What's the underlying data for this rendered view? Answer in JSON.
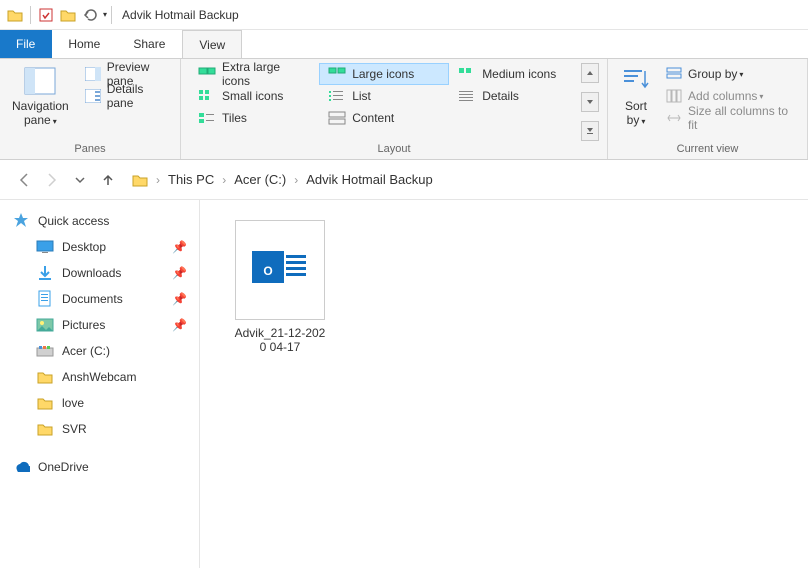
{
  "window": {
    "title": "Advik Hotmail Backup"
  },
  "tabs": {
    "file": "File",
    "home": "Home",
    "share": "Share",
    "view": "View"
  },
  "ribbon": {
    "panes": {
      "title": "Panes",
      "navigation_l1": "Navigation",
      "navigation_l2": "pane",
      "preview": "Preview pane",
      "details": "Details pane"
    },
    "layout": {
      "title": "Layout",
      "extra_large": "Extra large icons",
      "large": "Large icons",
      "medium": "Medium icons",
      "small": "Small icons",
      "list": "List",
      "details": "Details",
      "tiles": "Tiles",
      "content": "Content"
    },
    "current_view": {
      "title": "Current view",
      "sort_l1": "Sort",
      "sort_l2": "by",
      "group_by": "Group by",
      "add_columns": "Add columns",
      "size_all": "Size all columns to fit"
    }
  },
  "breadcrumbs": {
    "this_pc": "This PC",
    "drive": "Acer (C:)",
    "folder": "Advik Hotmail Backup"
  },
  "sidebar": {
    "quick_access": "Quick access",
    "desktop": "Desktop",
    "downloads": "Downloads",
    "documents": "Documents",
    "pictures": "Pictures",
    "acer": "Acer (C:)",
    "anshwebcam": "AnshWebcam",
    "love": "love",
    "svr": "SVR",
    "onedrive": "OneDrive"
  },
  "file": {
    "name_l1": "Advik_21-12-202",
    "name_l2": "0 04-17"
  }
}
